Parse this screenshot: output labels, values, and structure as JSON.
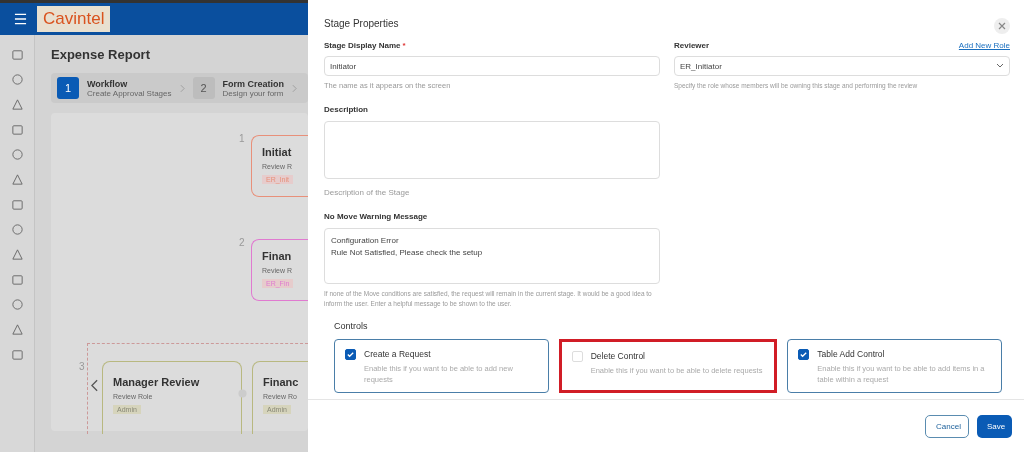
{
  "app": {
    "logo": "Cavintel",
    "page_title": "Expense Report",
    "steps": [
      {
        "number": "1",
        "title": "Workflow",
        "subtitle": "Create Approval Stages",
        "selected": true
      },
      {
        "number": "2",
        "title": "Form Creation",
        "subtitle": "Design your form",
        "selected": false
      }
    ],
    "stages": [
      {
        "number": "1",
        "title": "Initiat",
        "role": "Review R",
        "tag": "ER_Init",
        "color": "#e8907a"
      },
      {
        "number": "2",
        "title": "Finan",
        "role": "Review R",
        "tag": "ER_Fin",
        "color": "#e07ad0"
      }
    ],
    "parallel_group": {
      "number": "3",
      "stages": [
        {
          "title": "Manager Review",
          "role": "Review Role",
          "tag": "Admin"
        },
        {
          "title": "Financ",
          "role": "Review Ro",
          "tag": "Admin"
        }
      ]
    }
  },
  "dialog": {
    "title": "Stage Properties",
    "display_name": {
      "label": "Stage Display Name",
      "required_mark": "*",
      "value": "Initiator",
      "hint": "The name as it appears on the screen"
    },
    "reviewer": {
      "label": "Reviewer",
      "link": "Add New Role",
      "value": "ER_Initiator",
      "hint": "Specify the role whose members will be owning this stage and performing the review"
    },
    "description": {
      "label": "Description",
      "hint": "Description of the Stage"
    },
    "warning": {
      "label": "No Move Warning Message",
      "lines": [
        "Configuration Error",
        "Rule Not Satisfied, Please check the setup"
      ],
      "hint": "If none of the Move conditions are satisfied, the request will remain in the current stage. It would be a good idea to inform the user. Enter a helpful message to be shown to the user."
    },
    "controls_title": "Controls",
    "controls": [
      {
        "title": "Create a Request",
        "description": "Enable this if you want to be able to add new requests",
        "checked": true,
        "highlighted": false
      },
      {
        "title": "Delete Control",
        "description": "Enable this if you want to be able to delete requests",
        "checked": false,
        "highlighted": true
      },
      {
        "title": "Table Add Control",
        "description": "Enable this if you want to be able to add items in a table within a request",
        "checked": true,
        "highlighted": false
      }
    ],
    "buttons": {
      "cancel": "Cancel",
      "save": "Save"
    }
  }
}
